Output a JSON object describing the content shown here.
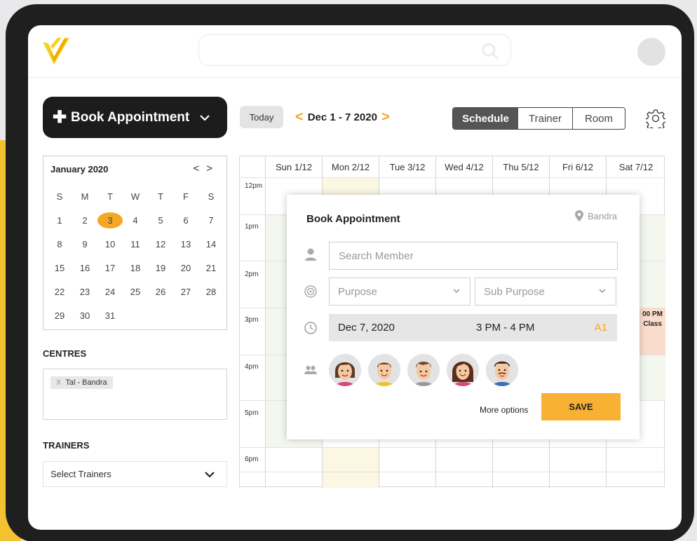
{
  "header": {
    "logo_icon": "v-logo-icon",
    "search_icon": "search-icon",
    "avatar_icon": "avatar-icon"
  },
  "toolbar": {
    "book_label": "Book Appointment",
    "today_label": "Today",
    "prev_arrow": "<",
    "next_arrow": ">",
    "date_range": "Dec 1 - 7 2020",
    "views": [
      "Schedule",
      "Trainer",
      "Room"
    ],
    "active_view": "Schedule",
    "accent_color": "#f5a623"
  },
  "mini_calendar": {
    "title": "January 2020",
    "prev": "<",
    "next": ">",
    "weekdays": [
      "S",
      "M",
      "T",
      "W",
      "T",
      "F",
      "S"
    ],
    "weeks": [
      [
        "1",
        "2",
        "3",
        "4",
        "5",
        "6",
        "7"
      ],
      [
        "8",
        "9",
        "10",
        "11",
        "12",
        "13",
        "14"
      ],
      [
        "15",
        "16",
        "17",
        "18",
        "19",
        "20",
        "21"
      ],
      [
        "22",
        "23",
        "24",
        "25",
        "26",
        "27",
        "28"
      ],
      [
        "29",
        "30",
        "31",
        "",
        "",
        "",
        ""
      ]
    ],
    "selected": "3"
  },
  "sidebar": {
    "centres_label": "CENTRES",
    "centre_chip": "Tal - Bandra",
    "chip_remove": "X",
    "trainers_label": "TRAINERS",
    "trainers_placeholder": "Select Trainers"
  },
  "calendar": {
    "days": [
      "Sun 1/12",
      "Mon 2/12",
      "Tue 3/12",
      "Wed 4/12",
      "Thu 5/12",
      "Fri 6/12",
      "Sat 7/12"
    ],
    "times": [
      "12pm",
      "1pm",
      "2pm",
      "3pm",
      "4pm",
      "5pm",
      "6pm"
    ],
    "event_time": "00 PM",
    "event_name": "Class"
  },
  "modal": {
    "title": "Book Appointment",
    "location": "Bandra",
    "member_placeholder": "Search Member",
    "purpose_placeholder": "Purpose",
    "sub_purpose_placeholder": "Sub Purpose",
    "date": "Dec 7, 2020",
    "time": "3 PM - 4 PM",
    "room": "A1",
    "more_options": "More options",
    "save_label": "SAVE",
    "save_color": "#f8b133"
  }
}
